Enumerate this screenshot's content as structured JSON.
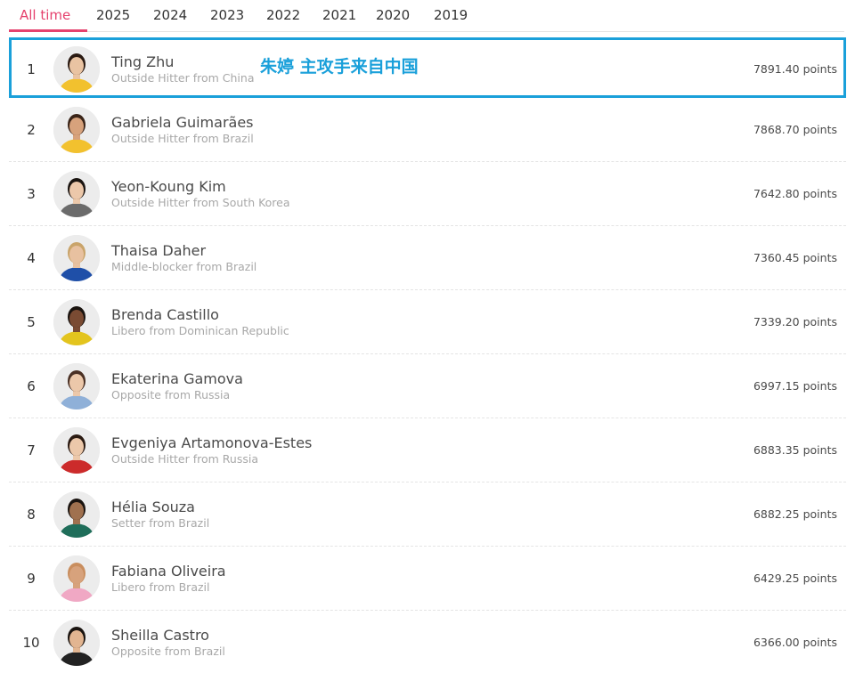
{
  "tabs": {
    "items": [
      "All time",
      "2025",
      "2024",
      "2023",
      "2022",
      "2021",
      "2020",
      "2019"
    ],
    "active": "All time"
  },
  "highlight_label": "朱婷 主攻手来自中国",
  "players": [
    {
      "rank": "1",
      "name": "Ting Zhu",
      "subtitle": "Outside Hitter from China",
      "points": "7891.40 points",
      "kit_color": "#f2c12e",
      "skin": "#e9c3a2",
      "hair": "#2a1a12"
    },
    {
      "rank": "2",
      "name": "Gabriela Guimarães",
      "subtitle": "Outside Hitter from Brazil",
      "points": "7868.70 points",
      "kit_color": "#f2c12e",
      "skin": "#d7a27c",
      "hair": "#3a2418"
    },
    {
      "rank": "3",
      "name": "Yeon-Koung Kim",
      "subtitle": "Outside Hitter from South Korea",
      "points": "7642.80 points",
      "kit_color": "#6b6b6b",
      "skin": "#ecc8aa",
      "hair": "#1a1410"
    },
    {
      "rank": "4",
      "name": "Thaisa Daher",
      "subtitle": "Middle-blocker from Brazil",
      "points": "7360.45 points",
      "kit_color": "#1f4fa8",
      "skin": "#e8c1a0",
      "hair": "#c9a46a"
    },
    {
      "rank": "5",
      "name": "Brenda Castillo",
      "subtitle": "Libero from Dominican Republic",
      "points": "7339.20 points",
      "kit_color": "#e3c41e",
      "skin": "#7a4b33",
      "hair": "#1a1410"
    },
    {
      "rank": "6",
      "name": "Ekaterina Gamova",
      "subtitle": "Opposite from Russia",
      "points": "6997.15 points",
      "kit_color": "#8fb0d8",
      "skin": "#ecc8aa",
      "hair": "#4a3024"
    },
    {
      "rank": "7",
      "name": "Evgeniya Artamonova-Estes",
      "subtitle": "Outside Hitter from Russia",
      "points": "6883.35 points",
      "kit_color": "#cc2b2b",
      "skin": "#ecc8aa",
      "hair": "#2a1a12"
    },
    {
      "rank": "8",
      "name": "Hélia Souza",
      "subtitle": "Setter from Brazil",
      "points": "6882.25 points",
      "kit_color": "#1f6e5a",
      "skin": "#a0714f",
      "hair": "#1a1410"
    },
    {
      "rank": "9",
      "name": "Fabiana Oliveira",
      "subtitle": "Libero from Brazil",
      "points": "6429.25 points",
      "kit_color": "#f0a8c4",
      "skin": "#d7a27c",
      "hair": "#c98e5e"
    },
    {
      "rank": "10",
      "name": "Sheilla Castro",
      "subtitle": "Opposite from Brazil",
      "points": "6366.00 points",
      "kit_color": "#222222",
      "skin": "#e2b591",
      "hair": "#1a1410"
    }
  ],
  "colors": {
    "accent": "#e5416d",
    "highlight_border": "#1aa0da"
  }
}
